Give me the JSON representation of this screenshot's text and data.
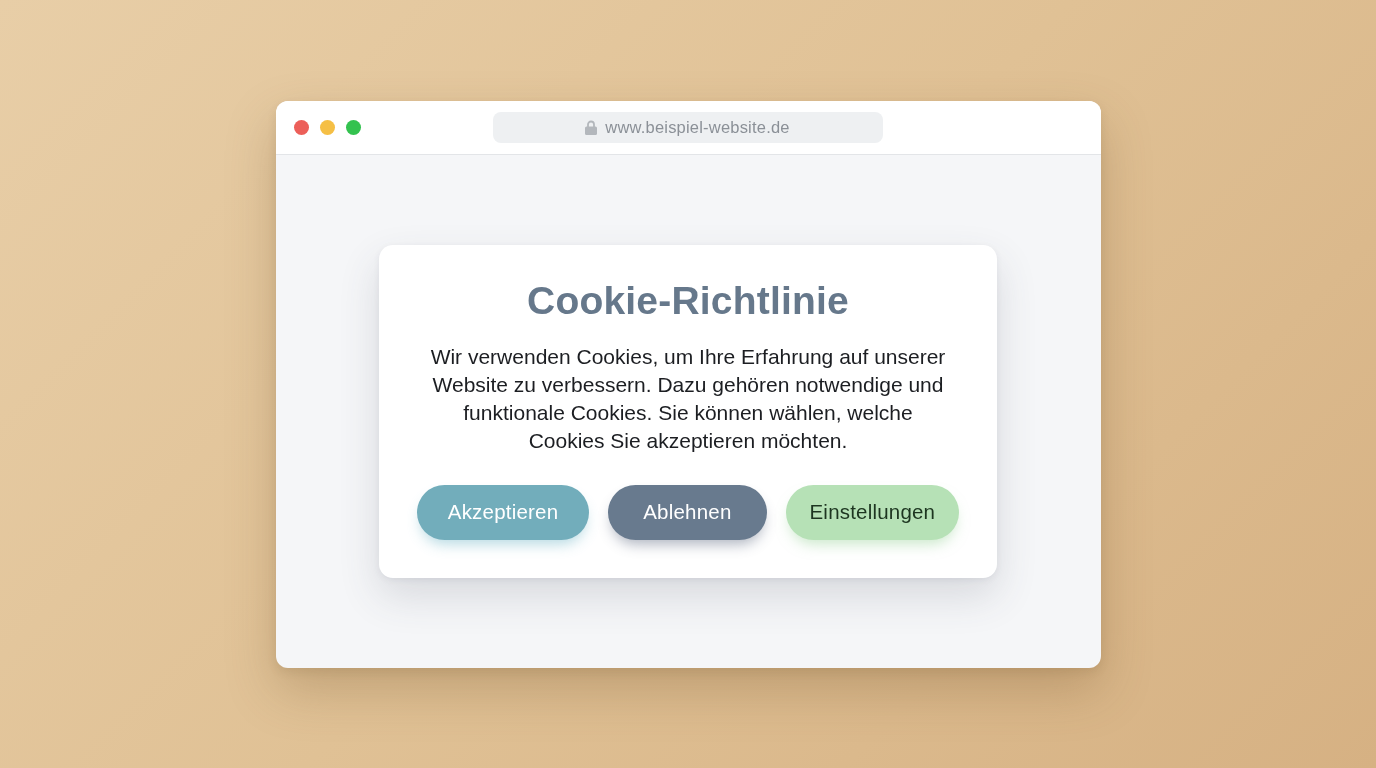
{
  "browser": {
    "address_bar": {
      "secure": true,
      "url": "www.beispiel-website.de"
    }
  },
  "cookie_dialog": {
    "title": "Cookie-Richtlinie",
    "message": "Wir verwenden Cookies, um Ihre Erfahrung auf unserer Website zu verbessern. Dazu gehören notwendige und funktionale Cookies. Sie können wählen, welche Cookies Sie akzeptieren möchten.",
    "buttons": [
      {
        "label": "Akzeptieren",
        "kind": "accept"
      },
      {
        "label": "Ablehnen",
        "kind": "reject"
      },
      {
        "label": "Einstellungen",
        "kind": "settings"
      }
    ]
  }
}
